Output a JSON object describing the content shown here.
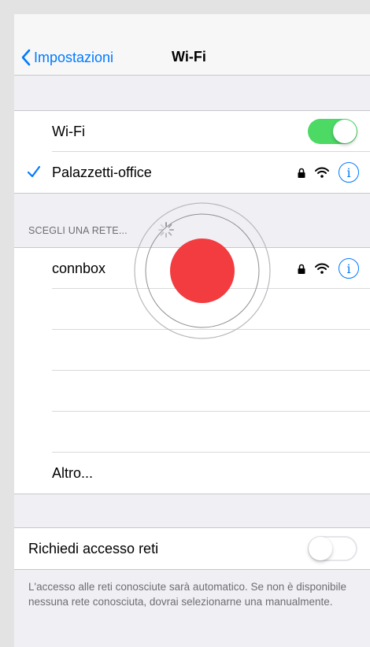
{
  "navbar": {
    "back_label": "Impostazioni",
    "title": "Wi-Fi"
  },
  "wifi_group": {
    "toggle_label": "Wi-Fi",
    "toggle_on": true,
    "connected_network": "Palazzetti-office"
  },
  "networks_section": {
    "header": "SCEGLI UNA RETE...",
    "networks": [
      {
        "name": "connbox",
        "secured": true
      }
    ],
    "other_label": "Altro..."
  },
  "ask_join": {
    "label": "Richiedi accesso reti",
    "enabled": false,
    "note": "L'accesso alle reti conosciute sarà automatico. Se non è disponibile nessuna rete conosciuta, dovrai selezionarne una manualmente."
  },
  "colors": {
    "accent": "#007aff",
    "switch_on": "#4cd964",
    "touch_indicator": "#f23c40"
  },
  "icons": [
    "chevron-left-icon",
    "checkmark-icon",
    "lock-icon",
    "wifi-icon",
    "info-icon",
    "spinner-icon"
  ]
}
